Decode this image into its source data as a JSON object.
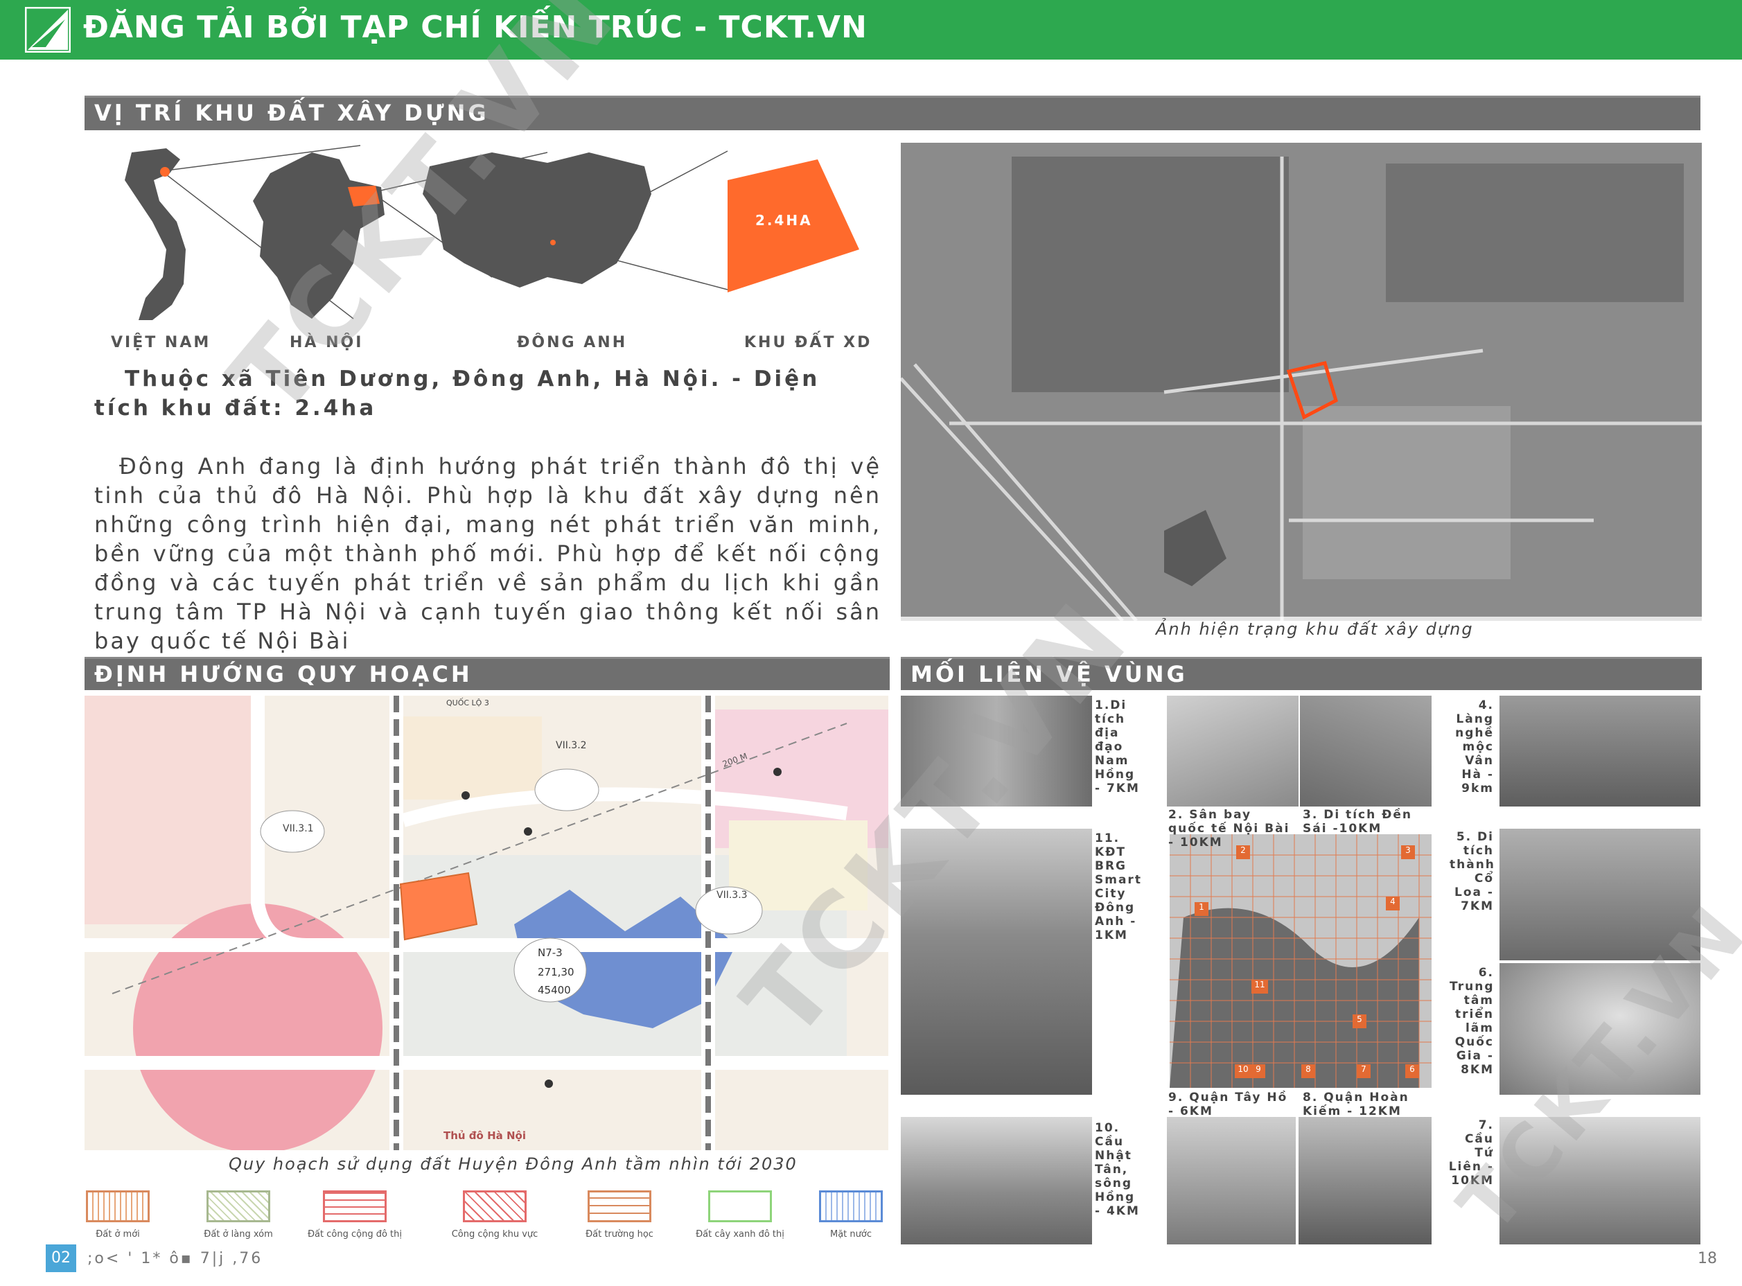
{
  "header": {
    "title": "ĐĂNG TẢI BỞI TẠP CHÍ KIẾN TRÚC - TCKT.VN"
  },
  "sections": {
    "location": "VỊ TRÍ KHU ĐẤT XÂY DỰNG",
    "planning": "ĐỊNH HƯỚNG QUY HOẠCH",
    "region": "MỐI LIÊN VỆ VÙNG"
  },
  "location_maps": {
    "labels": [
      "VIỆT NAM",
      "HÀ NỘI",
      "ĐÔNG ANH",
      "KHU ĐẤT XD"
    ],
    "site_area": "2.4HA"
  },
  "intro": {
    "lead": "Thuộc xã Tiên Dương, Đông Anh, Hà Nội. - Diện tích  khu đất: 2.4ha",
    "body": "Đông Anh đang là định hướng phát triển thành đô thị vệ tinh của thủ đô Hà Nội. Phù hợp là khu đất xây dựng nên những công trình hiện đại, mang nét phát triển văn minh, bền vững của một thành phố mới. Phù hợp để kết nối cộng đồng và các tuyến phát triển về sản phẩm du lịch khi gần trung tâm TP Hà Nội và cạnh tuyến giao thông kết nối sân bay quốc tế Nội Bài"
  },
  "aerial": {
    "caption": "Ảnh hiện trạng khu đất xây dựng"
  },
  "plan_map": {
    "caption": "Quy hoạch sử dụng đất Huyện Đông Anh tầm nhìn tới 2030",
    "block_main": [
      "N7-3",
      "271,30",
      "45400"
    ],
    "block_a": [
      "VII.3.2"
    ],
    "block_b": [
      "VII.3.1"
    ],
    "block_c": [
      "VII.3.3"
    ],
    "footer_text": "Thủ đô Hà Nội",
    "road_label": "QUỐC LỘ 3",
    "dist_label": "200 M"
  },
  "legend": [
    {
      "label": "Đất ở mới",
      "color": "#e7a679"
    },
    {
      "label": "Đất ở làng xóm",
      "color": "#c9d7b0"
    },
    {
      "label": "Đất công cộng đô thị",
      "color": "#e46b6b"
    },
    {
      "label": "Công cộng khu vực",
      "color": "#e46b6b"
    },
    {
      "label": "Đất trường học",
      "color": "#d98a5e"
    },
    {
      "label": "Đất cây xanh đô thị",
      "color": "#8ed47a"
    },
    {
      "label": "Mặt nước",
      "color": "#5b8bd6"
    }
  ],
  "region": {
    "l1": "1.Di tích địa đạo Nam Hồng - 7KM",
    "l2": "2. Sân bay quốc tế Nội Bài - 10KM",
    "l3": "3. Di tích Đền Sái -10KM",
    "l4": "4. Làng nghề mộc Vân Hà - 9km",
    "l5": "5. Di tích thành Cổ Loa - 7KM",
    "l6": "6. Trung tâm triển lãm Quốc Gia - 8KM",
    "l7": "7. Cầu Tứ Liên - 10KM",
    "l8": "8. Quận Hoàn Kiếm - 12KM",
    "l9": "9. Quận Tây Hồ - 6KM",
    "l10": "10. Cầu Nhật Tân, sông Hồng - 4KM",
    "l11": "11. KĐT BRG Smart City Đông Anh - 1KM",
    "markers": [
      "1",
      "2",
      "3",
      "4",
      "5",
      "6",
      "7",
      "8",
      "9",
      "10",
      "11"
    ]
  },
  "footer": {
    "left_page": "02",
    "left_code": ";o<  '  1*  ô▪  7|j ,76",
    "right_page": "18"
  },
  "watermark": "TCKT.VN",
  "colors": {
    "brand_green": "#2da84f",
    "site_orange": "#ff6a2c",
    "section_gray": "#6f6f6f"
  }
}
